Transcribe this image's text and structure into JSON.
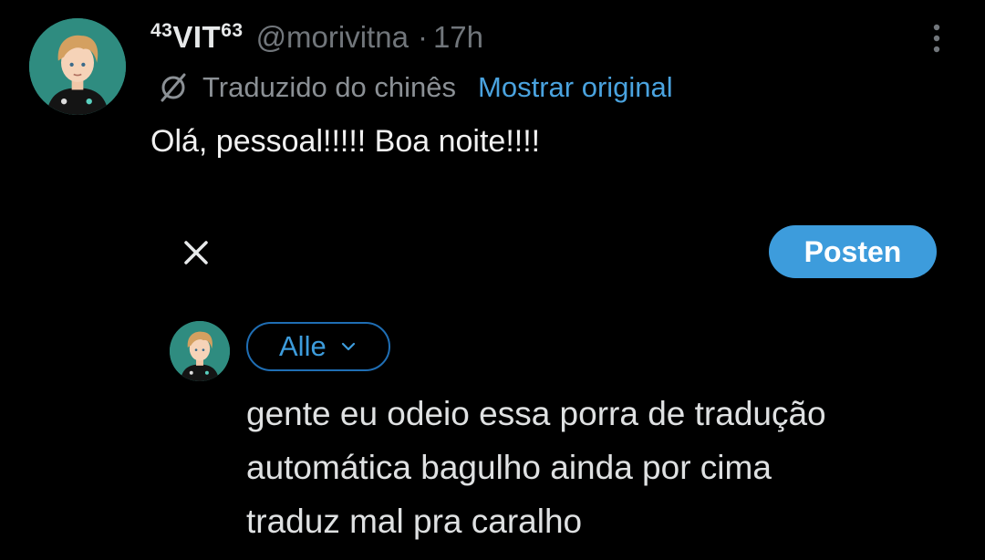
{
  "tweet": {
    "author": {
      "display_name_prefix": "43",
      "display_name_main": "VIT",
      "display_name_suffix": "63",
      "handle": "@morivitna",
      "separator": "·",
      "time": "17h"
    },
    "translation": {
      "label": "Traduzido do chinês",
      "show_original": "Mostrar original"
    },
    "text": "Olá, pessoal!!!!! Boa noite!!!!"
  },
  "composer": {
    "post_label": "Posten",
    "audience_label": "Alle",
    "reply_lines": [
      "gente eu odeio essa porra de tradução",
      "automática bagulho ainda por cima",
      "traduz mal pra caralho"
    ]
  },
  "colors": {
    "background": "#000000",
    "accent": "#3d9cdc",
    "link": "#4aa3df",
    "muted_text": "#71767b",
    "primary_text": "#e7e9ea"
  },
  "icons": {
    "more": "more-vertical-icon",
    "translate": "globe-slash-icon",
    "close": "close-icon",
    "dropdown": "chevron-down-icon"
  }
}
